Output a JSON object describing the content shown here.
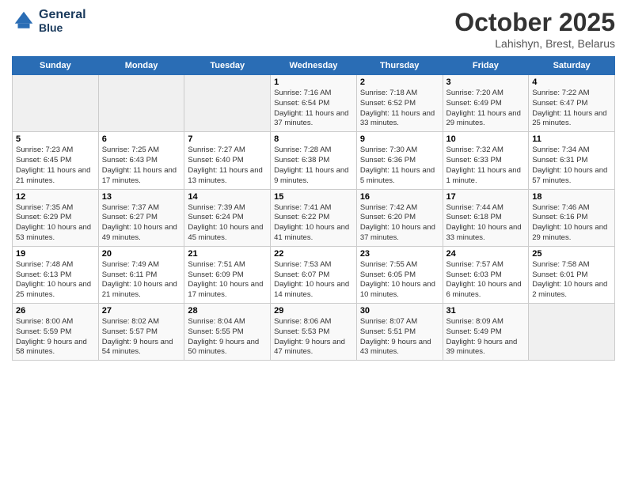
{
  "header": {
    "logo_line1": "General",
    "logo_line2": "Blue",
    "title": "October 2025",
    "subtitle": "Lahishyn, Brest, Belarus"
  },
  "days_of_week": [
    "Sunday",
    "Monday",
    "Tuesday",
    "Wednesday",
    "Thursday",
    "Friday",
    "Saturday"
  ],
  "weeks": [
    [
      {
        "day": "",
        "info": ""
      },
      {
        "day": "",
        "info": ""
      },
      {
        "day": "",
        "info": ""
      },
      {
        "day": "1",
        "info": "Sunrise: 7:16 AM\nSunset: 6:54 PM\nDaylight: 11 hours and 37 minutes."
      },
      {
        "day": "2",
        "info": "Sunrise: 7:18 AM\nSunset: 6:52 PM\nDaylight: 11 hours and 33 minutes."
      },
      {
        "day": "3",
        "info": "Sunrise: 7:20 AM\nSunset: 6:49 PM\nDaylight: 11 hours and 29 minutes."
      },
      {
        "day": "4",
        "info": "Sunrise: 7:22 AM\nSunset: 6:47 PM\nDaylight: 11 hours and 25 minutes."
      }
    ],
    [
      {
        "day": "5",
        "info": "Sunrise: 7:23 AM\nSunset: 6:45 PM\nDaylight: 11 hours and 21 minutes."
      },
      {
        "day": "6",
        "info": "Sunrise: 7:25 AM\nSunset: 6:43 PM\nDaylight: 11 hours and 17 minutes."
      },
      {
        "day": "7",
        "info": "Sunrise: 7:27 AM\nSunset: 6:40 PM\nDaylight: 11 hours and 13 minutes."
      },
      {
        "day": "8",
        "info": "Sunrise: 7:28 AM\nSunset: 6:38 PM\nDaylight: 11 hours and 9 minutes."
      },
      {
        "day": "9",
        "info": "Sunrise: 7:30 AM\nSunset: 6:36 PM\nDaylight: 11 hours and 5 minutes."
      },
      {
        "day": "10",
        "info": "Sunrise: 7:32 AM\nSunset: 6:33 PM\nDaylight: 11 hours and 1 minute."
      },
      {
        "day": "11",
        "info": "Sunrise: 7:34 AM\nSunset: 6:31 PM\nDaylight: 10 hours and 57 minutes."
      }
    ],
    [
      {
        "day": "12",
        "info": "Sunrise: 7:35 AM\nSunset: 6:29 PM\nDaylight: 10 hours and 53 minutes."
      },
      {
        "day": "13",
        "info": "Sunrise: 7:37 AM\nSunset: 6:27 PM\nDaylight: 10 hours and 49 minutes."
      },
      {
        "day": "14",
        "info": "Sunrise: 7:39 AM\nSunset: 6:24 PM\nDaylight: 10 hours and 45 minutes."
      },
      {
        "day": "15",
        "info": "Sunrise: 7:41 AM\nSunset: 6:22 PM\nDaylight: 10 hours and 41 minutes."
      },
      {
        "day": "16",
        "info": "Sunrise: 7:42 AM\nSunset: 6:20 PM\nDaylight: 10 hours and 37 minutes."
      },
      {
        "day": "17",
        "info": "Sunrise: 7:44 AM\nSunset: 6:18 PM\nDaylight: 10 hours and 33 minutes."
      },
      {
        "day": "18",
        "info": "Sunrise: 7:46 AM\nSunset: 6:16 PM\nDaylight: 10 hours and 29 minutes."
      }
    ],
    [
      {
        "day": "19",
        "info": "Sunrise: 7:48 AM\nSunset: 6:13 PM\nDaylight: 10 hours and 25 minutes."
      },
      {
        "day": "20",
        "info": "Sunrise: 7:49 AM\nSunset: 6:11 PM\nDaylight: 10 hours and 21 minutes."
      },
      {
        "day": "21",
        "info": "Sunrise: 7:51 AM\nSunset: 6:09 PM\nDaylight: 10 hours and 17 minutes."
      },
      {
        "day": "22",
        "info": "Sunrise: 7:53 AM\nSunset: 6:07 PM\nDaylight: 10 hours and 14 minutes."
      },
      {
        "day": "23",
        "info": "Sunrise: 7:55 AM\nSunset: 6:05 PM\nDaylight: 10 hours and 10 minutes."
      },
      {
        "day": "24",
        "info": "Sunrise: 7:57 AM\nSunset: 6:03 PM\nDaylight: 10 hours and 6 minutes."
      },
      {
        "day": "25",
        "info": "Sunrise: 7:58 AM\nSunset: 6:01 PM\nDaylight: 10 hours and 2 minutes."
      }
    ],
    [
      {
        "day": "26",
        "info": "Sunrise: 8:00 AM\nSunset: 5:59 PM\nDaylight: 9 hours and 58 minutes."
      },
      {
        "day": "27",
        "info": "Sunrise: 8:02 AM\nSunset: 5:57 PM\nDaylight: 9 hours and 54 minutes."
      },
      {
        "day": "28",
        "info": "Sunrise: 8:04 AM\nSunset: 5:55 PM\nDaylight: 9 hours and 50 minutes."
      },
      {
        "day": "29",
        "info": "Sunrise: 8:06 AM\nSunset: 5:53 PM\nDaylight: 9 hours and 47 minutes."
      },
      {
        "day": "30",
        "info": "Sunrise: 8:07 AM\nSunset: 5:51 PM\nDaylight: 9 hours and 43 minutes."
      },
      {
        "day": "31",
        "info": "Sunrise: 8:09 AM\nSunset: 5:49 PM\nDaylight: 9 hours and 39 minutes."
      },
      {
        "day": "",
        "info": ""
      }
    ]
  ]
}
